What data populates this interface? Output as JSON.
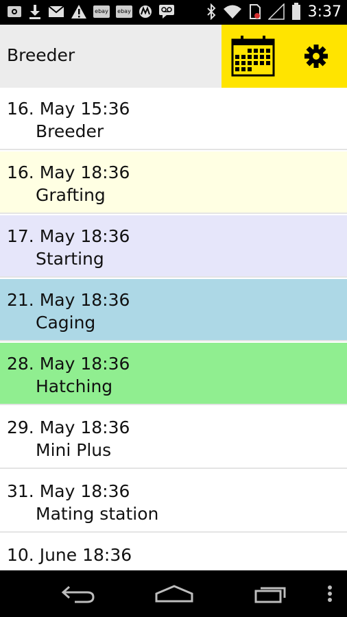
{
  "status_bar": {
    "icons": [
      "gallery-notification-icon",
      "download-icon",
      "mail-icon",
      "warning-icon",
      "ebay-icon",
      "ebay-icon",
      "motorola-icon",
      "voicemail-icon",
      "bluetooth-icon",
      "wifi-icon",
      "sim-icon",
      "signal-icon",
      "battery-icon"
    ],
    "ebay_label": "ebay",
    "time": "3:37"
  },
  "app_bar": {
    "title": "Breeder",
    "calendar_icon": "calendar-icon",
    "settings_icon": "gear-icon",
    "actions_bg": "#ffe400"
  },
  "list": {
    "items": [
      {
        "date": "16. May 15:36",
        "label": "Breeder",
        "color": "#ffffff"
      },
      {
        "date": "16. May 18:36",
        "label": "Grafting",
        "color": "#ffffe3"
      },
      {
        "date": "17. May 18:36",
        "label": "Starting",
        "color": "#e6e6fa"
      },
      {
        "date": "21. May 18:36",
        "label": "Caging",
        "color": "#add8e6"
      },
      {
        "date": "28. May 18:36",
        "label": "Hatching",
        "color": "#90ee90"
      },
      {
        "date": "29. May 18:36",
        "label": "Mini Plus",
        "color": "#ffffff"
      },
      {
        "date": "31. May 18:36",
        "label": "Mating station",
        "color": "#ffffff"
      },
      {
        "date": "10. June 18:36",
        "label": "",
        "color": "#ffffff"
      }
    ]
  },
  "nav_bar": {
    "buttons": [
      "back-icon",
      "home-icon",
      "recent-apps-icon",
      "overflow-menu-icon"
    ]
  }
}
